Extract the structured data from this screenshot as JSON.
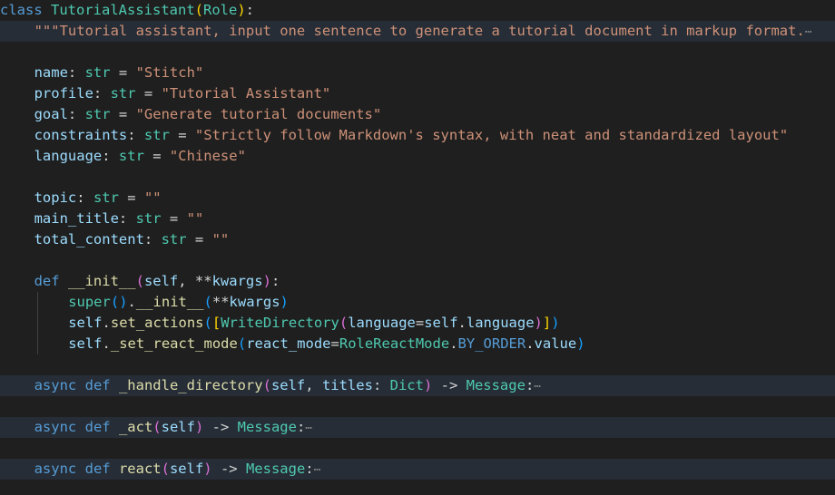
{
  "editor": {
    "language": "python",
    "colors": {
      "background": "#1f1f1f",
      "folded_line_background": "#262d36",
      "keyword": "#569cd6",
      "class_name": "#4ec9b0",
      "function": "#dcdcaa",
      "variable": "#9cdcfe",
      "string": "#ce9178"
    },
    "fold_marker": "⋯",
    "lines": [
      {
        "indent": 0,
        "folded": false,
        "tokens": [
          [
            "kw",
            "class"
          ],
          [
            "op",
            " "
          ],
          [
            "cls",
            "TutorialAssistant"
          ],
          [
            "p1",
            "("
          ],
          [
            "cls",
            "Role"
          ],
          [
            "p1",
            ")"
          ],
          [
            "op",
            ":"
          ]
        ]
      },
      {
        "indent": 1,
        "folded": true,
        "tokens": [
          [
            "str",
            "\"\"\"Tutorial assistant, input one sentence to generate a tutorial document in markup format."
          ]
        ]
      },
      {
        "indent": 0,
        "folded": false,
        "tokens": []
      },
      {
        "indent": 1,
        "folded": false,
        "tokens": [
          [
            "var",
            "name"
          ],
          [
            "op",
            ": "
          ],
          [
            "cls",
            "str"
          ],
          [
            "op",
            " = "
          ],
          [
            "str",
            "\"Stitch\""
          ]
        ]
      },
      {
        "indent": 1,
        "folded": false,
        "tokens": [
          [
            "var",
            "profile"
          ],
          [
            "op",
            ": "
          ],
          [
            "cls",
            "str"
          ],
          [
            "op",
            " = "
          ],
          [
            "str",
            "\"Tutorial Assistant\""
          ]
        ]
      },
      {
        "indent": 1,
        "folded": false,
        "tokens": [
          [
            "var",
            "goal"
          ],
          [
            "op",
            ": "
          ],
          [
            "cls",
            "str"
          ],
          [
            "op",
            " = "
          ],
          [
            "str",
            "\"Generate tutorial documents\""
          ]
        ]
      },
      {
        "indent": 1,
        "folded": false,
        "tokens": [
          [
            "var",
            "constraints"
          ],
          [
            "op",
            ": "
          ],
          [
            "cls",
            "str"
          ],
          [
            "op",
            " = "
          ],
          [
            "str",
            "\"Strictly follow Markdown's syntax, with neat and standardized layout\""
          ]
        ]
      },
      {
        "indent": 1,
        "folded": false,
        "tokens": [
          [
            "var",
            "language"
          ],
          [
            "op",
            ": "
          ],
          [
            "cls",
            "str"
          ],
          [
            "op",
            " = "
          ],
          [
            "str",
            "\"Chinese\""
          ]
        ]
      },
      {
        "indent": 0,
        "folded": false,
        "tokens": []
      },
      {
        "indent": 1,
        "folded": false,
        "tokens": [
          [
            "var",
            "topic"
          ],
          [
            "op",
            ": "
          ],
          [
            "cls",
            "str"
          ],
          [
            "op",
            " = "
          ],
          [
            "str",
            "\"\""
          ]
        ]
      },
      {
        "indent": 1,
        "folded": false,
        "tokens": [
          [
            "var",
            "main_title"
          ],
          [
            "op",
            ": "
          ],
          [
            "cls",
            "str"
          ],
          [
            "op",
            " = "
          ],
          [
            "str",
            "\"\""
          ]
        ]
      },
      {
        "indent": 1,
        "folded": false,
        "tokens": [
          [
            "var",
            "total_content"
          ],
          [
            "op",
            ": "
          ],
          [
            "cls",
            "str"
          ],
          [
            "op",
            " = "
          ],
          [
            "str",
            "\"\""
          ]
        ]
      },
      {
        "indent": 0,
        "folded": false,
        "tokens": []
      },
      {
        "indent": 1,
        "folded": false,
        "tokens": [
          [
            "kw",
            "def"
          ],
          [
            "op",
            " "
          ],
          [
            "fn",
            "__init__"
          ],
          [
            "p2",
            "("
          ],
          [
            "var",
            "self"
          ],
          [
            "op",
            ", **"
          ],
          [
            "var",
            "kwargs"
          ],
          [
            "p2",
            ")"
          ],
          [
            "op",
            ":"
          ]
        ]
      },
      {
        "indent": 2,
        "folded": false,
        "tokens": [
          [
            "cls",
            "super"
          ],
          [
            "p3",
            "()"
          ],
          [
            "op",
            "."
          ],
          [
            "fn",
            "__init__"
          ],
          [
            "p3",
            "("
          ],
          [
            "op",
            "**"
          ],
          [
            "var",
            "kwargs"
          ],
          [
            "p3",
            ")"
          ]
        ]
      },
      {
        "indent": 2,
        "folded": false,
        "tokens": [
          [
            "var",
            "self"
          ],
          [
            "op",
            "."
          ],
          [
            "fn",
            "set_actions"
          ],
          [
            "p3",
            "("
          ],
          [
            "p1",
            "["
          ],
          [
            "cls",
            "WriteDirectory"
          ],
          [
            "p2",
            "("
          ],
          [
            "var",
            "language"
          ],
          [
            "op",
            "="
          ],
          [
            "var",
            "self"
          ],
          [
            "op",
            "."
          ],
          [
            "var",
            "language"
          ],
          [
            "p2",
            ")"
          ],
          [
            "p1",
            "]"
          ],
          [
            "p3",
            ")"
          ]
        ]
      },
      {
        "indent": 2,
        "folded": false,
        "tokens": [
          [
            "var",
            "self"
          ],
          [
            "op",
            "."
          ],
          [
            "fn",
            "_set_react_mode"
          ],
          [
            "p3",
            "("
          ],
          [
            "var",
            "react_mode"
          ],
          [
            "op",
            "="
          ],
          [
            "cls",
            "RoleReactMode"
          ],
          [
            "op",
            "."
          ],
          [
            "kw",
            "BY_ORDER"
          ],
          [
            "op",
            "."
          ],
          [
            "var",
            "value"
          ],
          [
            "p3",
            ")"
          ]
        ]
      },
      {
        "indent": 0,
        "folded": false,
        "tokens": []
      },
      {
        "indent": 1,
        "folded": true,
        "tokens": [
          [
            "kw",
            "async"
          ],
          [
            "op",
            " "
          ],
          [
            "kw",
            "def"
          ],
          [
            "op",
            " "
          ],
          [
            "fn",
            "_handle_directory"
          ],
          [
            "p2",
            "("
          ],
          [
            "var",
            "self"
          ],
          [
            "op",
            ", "
          ],
          [
            "var",
            "titles"
          ],
          [
            "op",
            ": "
          ],
          [
            "cls",
            "Dict"
          ],
          [
            "p2",
            ")"
          ],
          [
            "op",
            " -> "
          ],
          [
            "cls",
            "Message"
          ],
          [
            "op",
            ":"
          ]
        ]
      },
      {
        "indent": 0,
        "folded": false,
        "tokens": []
      },
      {
        "indent": 1,
        "folded": true,
        "tokens": [
          [
            "kw",
            "async"
          ],
          [
            "op",
            " "
          ],
          [
            "kw",
            "def"
          ],
          [
            "op",
            " "
          ],
          [
            "fn",
            "_act"
          ],
          [
            "p2",
            "("
          ],
          [
            "var",
            "self"
          ],
          [
            "p2",
            ")"
          ],
          [
            "op",
            " -> "
          ],
          [
            "cls",
            "Message"
          ],
          [
            "op",
            ":"
          ]
        ]
      },
      {
        "indent": 0,
        "folded": false,
        "tokens": []
      },
      {
        "indent": 1,
        "folded": true,
        "tokens": [
          [
            "kw",
            "async"
          ],
          [
            "op",
            " "
          ],
          [
            "kw",
            "def"
          ],
          [
            "op",
            " "
          ],
          [
            "fn",
            "react"
          ],
          [
            "p2",
            "("
          ],
          [
            "var",
            "self"
          ],
          [
            "p2",
            ")"
          ],
          [
            "op",
            " -> "
          ],
          [
            "cls",
            "Message"
          ],
          [
            "op",
            ":"
          ]
        ]
      }
    ]
  }
}
